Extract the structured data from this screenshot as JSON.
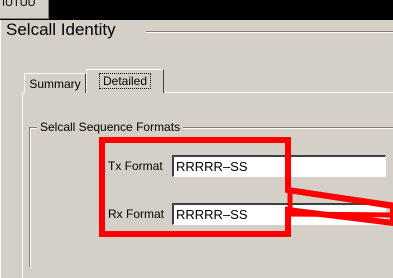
{
  "top_tab": {
    "label": "IUTUU"
  },
  "dialog": {
    "title": "Selcall Identity",
    "tabs": [
      {
        "label": "Summary",
        "selected": false
      },
      {
        "label": "Detailed",
        "selected": true
      }
    ],
    "group": {
      "title": "Selcall Sequence Formats",
      "fields": {
        "tx": {
          "label": "Tx Format",
          "value": "RRRRR–SS"
        },
        "rx": {
          "label": "Rx Format",
          "value": "RRRRR–SS"
        }
      }
    }
  },
  "annotation": {
    "color": "#ff0000",
    "shape": "highlight-box-with-pointer"
  }
}
